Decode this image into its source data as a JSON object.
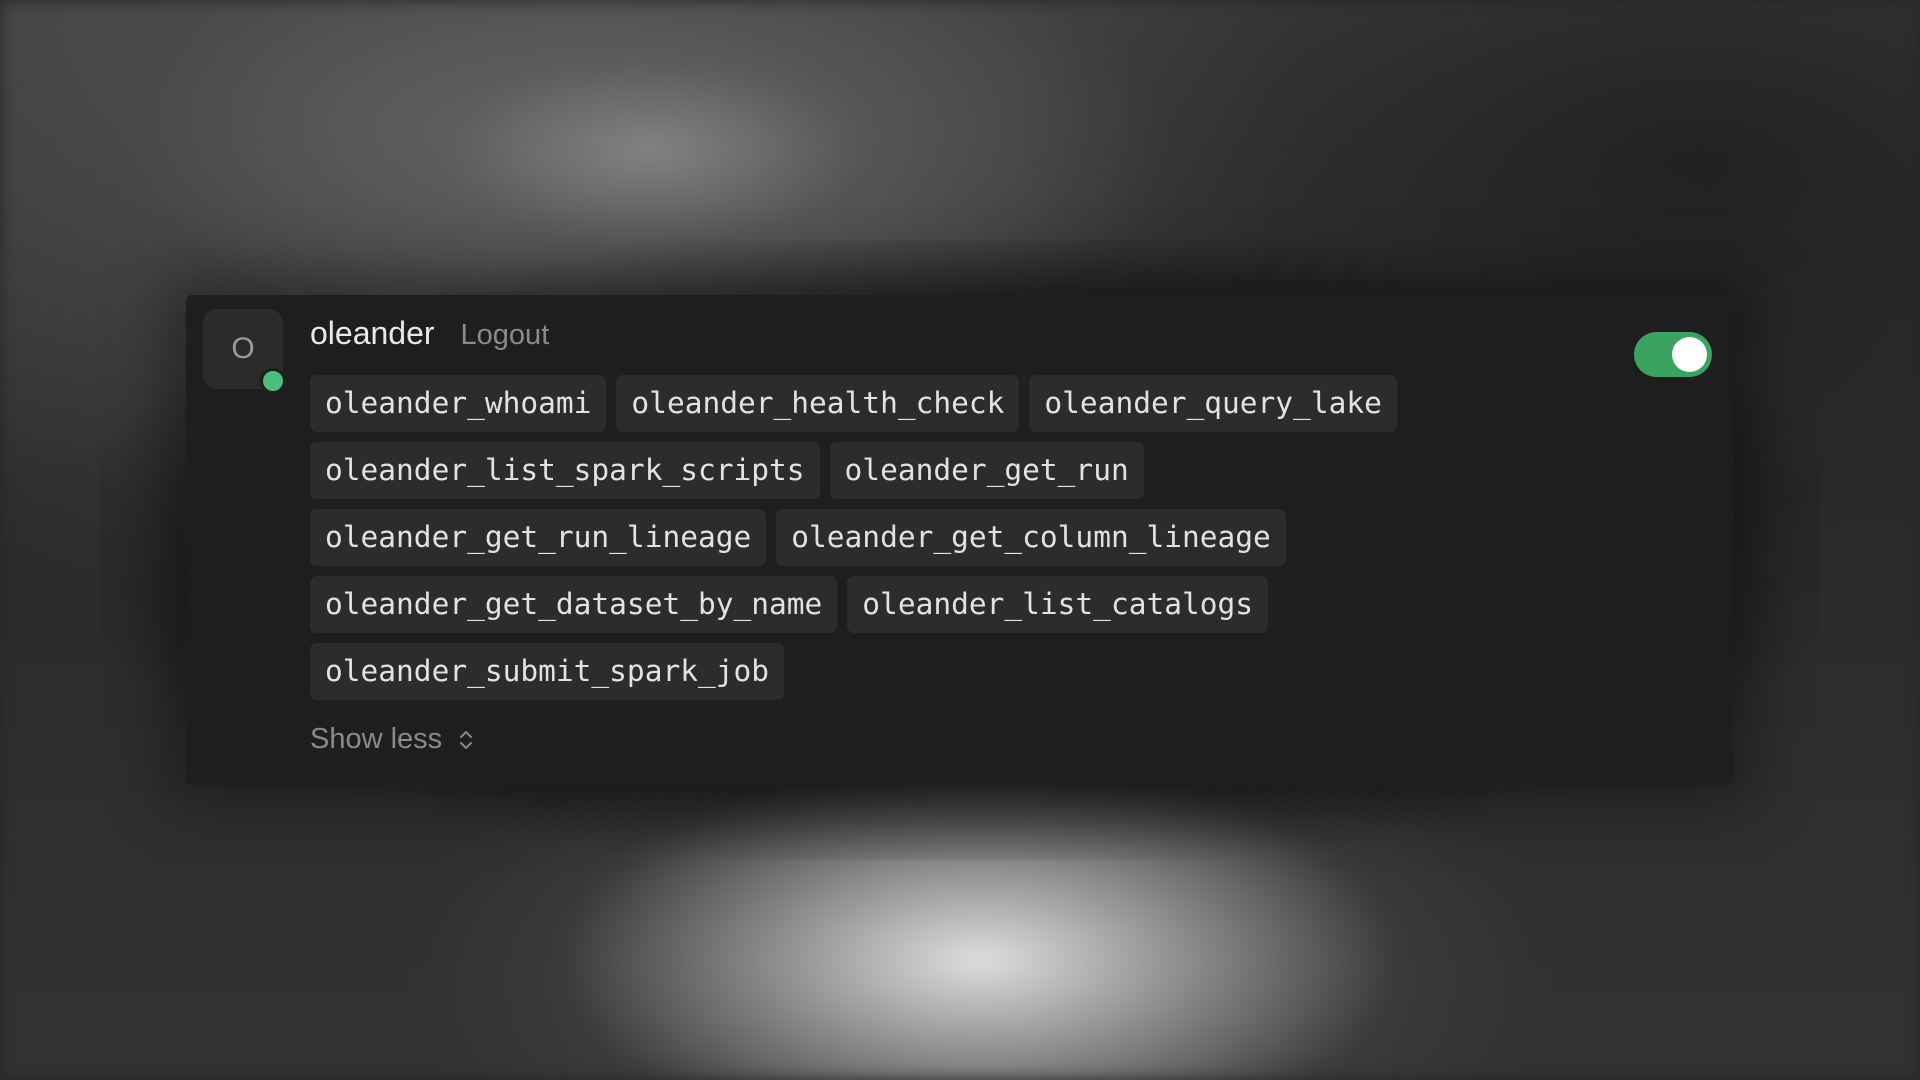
{
  "server": {
    "avatar_letter": "O",
    "name": "oleander",
    "logout_label": "Logout",
    "status": "connected",
    "status_color": "#4cbd7a",
    "enabled": true,
    "toggle_color": "#3aa35f"
  },
  "tools": [
    [
      "oleander_whoami",
      "oleander_health_check",
      "oleander_query_lake"
    ],
    [
      "oleander_list_spark_scripts",
      "oleander_get_run"
    ],
    [
      "oleander_get_run_lineage",
      "oleander_get_column_lineage"
    ],
    [
      "oleander_get_dataset_by_name",
      "oleander_list_catalogs"
    ],
    [
      "oleander_submit_spark_job"
    ]
  ],
  "footer": {
    "toggle_label": "Show less",
    "icon": "chevron-up-down-icon"
  }
}
